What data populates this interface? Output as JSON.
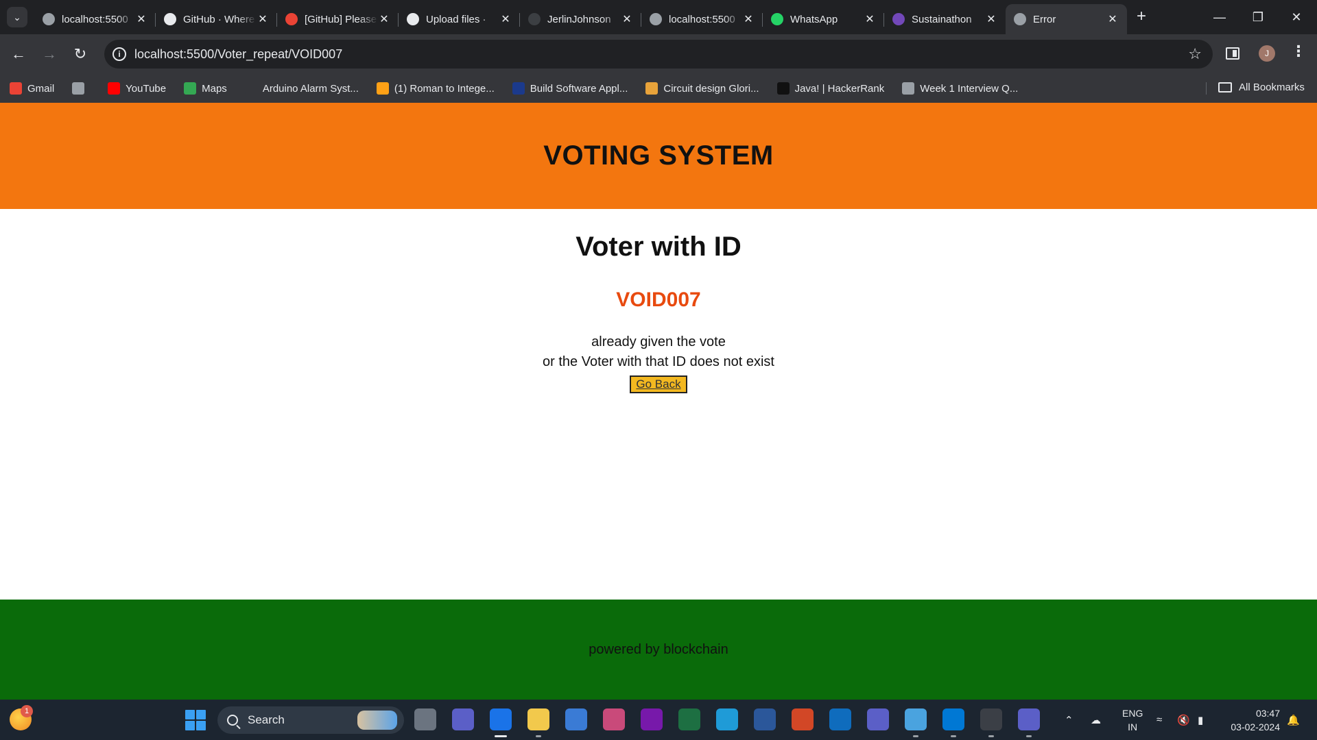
{
  "browser": {
    "tabs": [
      {
        "title": "localhost:5500",
        "icon": "globe-icon",
        "color": "#9aa0a6"
      },
      {
        "title": "GitHub · Where",
        "icon": "github-icon",
        "color": "#e8eaed"
      },
      {
        "title": "[GitHub] Please",
        "icon": "gmail-icon",
        "color": "#ea4335"
      },
      {
        "title": "Upload files ·",
        "icon": "github-icon",
        "color": "#e8eaed"
      },
      {
        "title": "JerlinJohnson",
        "icon": "github-icon",
        "color": "#3c3f43"
      },
      {
        "title": "localhost:5500",
        "icon": "globe-icon",
        "color": "#9aa0a6"
      },
      {
        "title": "WhatsApp",
        "icon": "whatsapp-icon",
        "color": "#25d366"
      },
      {
        "title": "Sustainathon",
        "icon": "forms-icon",
        "color": "#7248b9"
      },
      {
        "title": "Error",
        "icon": "globe-icon",
        "color": "#9aa0a6",
        "active": true
      }
    ],
    "url": "localhost:5500/Voter_repeat/VOID007",
    "avatar_initial": "J",
    "bookmarks": [
      {
        "label": "Gmail",
        "icon": "gmail-icon",
        "color": "#ea4335"
      },
      {
        "label": "",
        "icon": "globe-icon",
        "color": "#9aa0a6"
      },
      {
        "label": "YouTube",
        "icon": "youtube-icon",
        "color": "#ff0000"
      },
      {
        "label": "Maps",
        "icon": "maps-icon",
        "color": "#34a853"
      },
      {
        "label": "Arduino Alarm Syst...",
        "icon": "infinity-icon",
        "color": "#35363a"
      },
      {
        "label": "(1) Roman to Intege...",
        "icon": "leetcode-icon",
        "color": "#ffa116"
      },
      {
        "label": "Build Software Appl...",
        "icon": "app-icon",
        "color": "#1b3a8c"
      },
      {
        "label": "Circuit design Glori...",
        "icon": "tinkercad-icon",
        "color": "#e8a33a"
      },
      {
        "label": "Java! | HackerRank",
        "icon": "hackerrank-icon",
        "color": "#111111"
      },
      {
        "label": "Week 1 Interview Q...",
        "icon": "globe-icon",
        "color": "#9aa0a6"
      }
    ],
    "all_bookmarks": "All Bookmarks"
  },
  "page": {
    "header_title": "VOTING SYSTEM",
    "heading": "Voter with ID",
    "voter_id": "VOID007",
    "message_line1": "already given the vote",
    "message_line2": "or the Voter with that ID does not exist",
    "go_back_label": "Go Back",
    "footer_text": "powered by blockchain",
    "colors": {
      "header": "#f3760f",
      "footer": "#0a6b0a",
      "voter_id": "#e84a0f",
      "button": "#f3b820"
    }
  },
  "taskbar": {
    "search_label": "Search",
    "weather_badge": "1",
    "apps": [
      {
        "name": "task-view-icon",
        "color": "#6b7480"
      },
      {
        "name": "meet-icon",
        "color": "#5b5fc7"
      },
      {
        "name": "chrome-icon",
        "color": "#1a73e8",
        "active": true
      },
      {
        "name": "file-explorer-icon",
        "color": "#f2c94c"
      },
      {
        "name": "store-icon",
        "color": "#3a7bd5"
      },
      {
        "name": "snipping-tool-icon",
        "color": "#c94a7a"
      },
      {
        "name": "onenote-icon",
        "color": "#7719aa"
      },
      {
        "name": "excel-icon",
        "color": "#1d6f42"
      },
      {
        "name": "edge-icon",
        "color": "#1f9bd7"
      },
      {
        "name": "word-icon",
        "color": "#2b579a"
      },
      {
        "name": "powerpoint-icon",
        "color": "#d24726"
      },
      {
        "name": "outlook-icon",
        "color": "#0f6cbd"
      },
      {
        "name": "teams-icon",
        "color": "#5b5fc7"
      },
      {
        "name": "notepad-icon",
        "color": "#4aa3df"
      },
      {
        "name": "vscode-icon",
        "color": "#0078d4"
      },
      {
        "name": "terminal-icon",
        "color": "#3b3f46"
      },
      {
        "name": "teams-new-icon",
        "color": "#5b5fc7"
      }
    ],
    "lang_line1": "ENG",
    "lang_line2": "IN",
    "time": "03:47",
    "date": "03-02-2024"
  }
}
